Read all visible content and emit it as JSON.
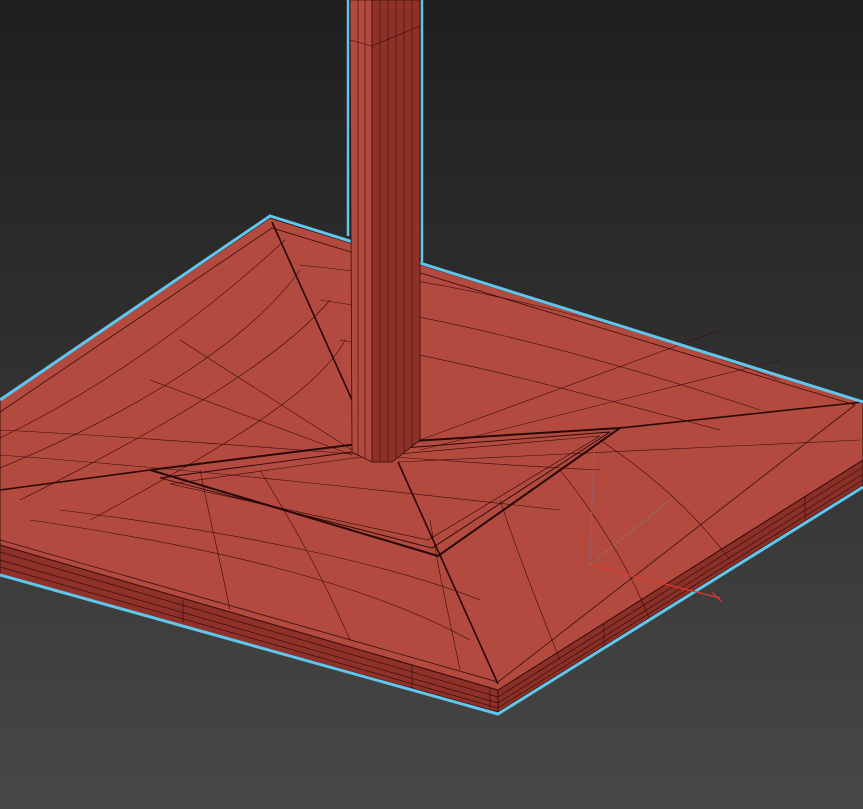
{
  "viewport": {
    "background_top": "#1f1f1f",
    "background_bottom": "#474747"
  },
  "model": {
    "object": "pole-with-square-base",
    "surface_color": "#b24a3f",
    "side_color": "#8e3229",
    "wire_color": "#3a0d0a",
    "selection_outline_color": "#5fc6ee",
    "selected": true
  },
  "gizmo": {
    "icon": "transform-gizmo-icon",
    "x_axis_color": "#e03a2a",
    "y_axis_color": "#7a8a6a",
    "z_axis_color": "#8a6a8a"
  }
}
